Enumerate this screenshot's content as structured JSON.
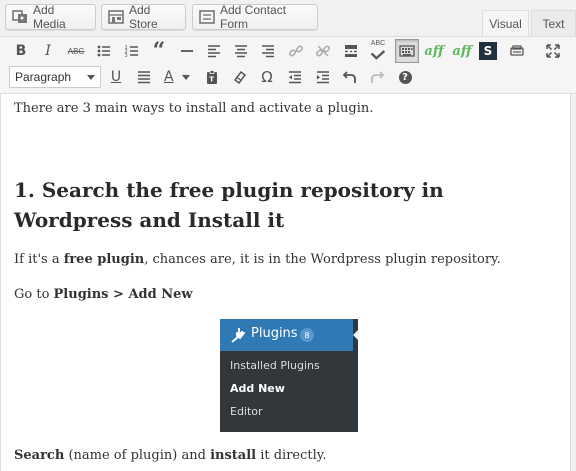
{
  "media_buttons": [
    {
      "label": "Add Media",
      "icon": "media-icon"
    },
    {
      "label": "Add Store",
      "icon": "store-icon"
    },
    {
      "label": "Add Contact Form",
      "icon": "form-icon"
    }
  ],
  "editor_tabs": {
    "visual": "Visual",
    "text": "Text"
  },
  "toolbar": {
    "row1": [
      "bold",
      "italic",
      "strikethrough",
      "bulleted-list",
      "numbered-list",
      "blockquote",
      "horizontal-line",
      "align-left",
      "align-center",
      "align-right",
      "insert-link",
      "remove-link",
      "read-more",
      "spellcheck",
      "toolbar-toggle",
      "aff-1",
      "aff-2",
      "s-plugin",
      "keyboard",
      "fullscreen"
    ],
    "format_value": "Paragraph",
    "row2": [
      "underline",
      "justify",
      "text-color",
      "paste-as-text",
      "clear-formatting",
      "special-character",
      "outdent",
      "indent",
      "undo",
      "redo",
      "help"
    ],
    "labels": {
      "bold": "B",
      "italic": "I",
      "strike": "ABC",
      "quote": "“",
      "underline": "U",
      "text_color": "A",
      "omega": "Ω",
      "spell": "ABC",
      "aff": "aff",
      "s": "S",
      "help": "?"
    }
  },
  "content": {
    "intro": "There are 3 main ways to install and activate a plugin.",
    "heading": "1. Search the free plugin repository in Wordpress and Install it",
    "p2": {
      "a": "If it's a ",
      "b": "free plugin",
      "c": ", chances are, it is in the Wordpress plugin repository."
    },
    "p3": {
      "a": "Go to ",
      "b": "Plugins > Add New"
    },
    "wp_menu": {
      "title": "Plugins",
      "badge": "8",
      "items": [
        "Installed Plugins",
        "Add New",
        "Editor"
      ]
    },
    "p4": {
      "a": "Search",
      "b": " (name of plugin) and ",
      "c": "install",
      "d": " it directly."
    }
  },
  "colors": {
    "accent": "#2f7ab5",
    "menu_bg": "#32373c",
    "aff_green": "#5cb85c"
  }
}
